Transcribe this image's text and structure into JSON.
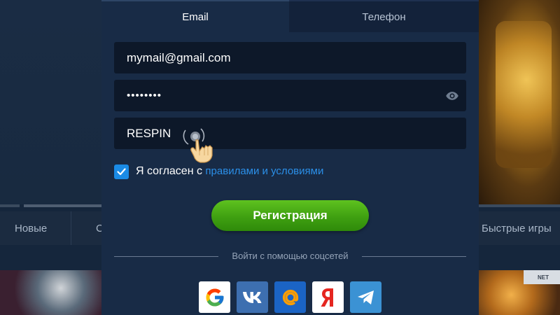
{
  "tabs": {
    "email": "Email",
    "phone": "Телефон"
  },
  "form": {
    "email_value": "mymail@gmail.com",
    "password_value": "••••••••",
    "promo_value": "RESPIN",
    "agree_prefix": "Я согласен с ",
    "agree_link": "правилами и условиями",
    "agree_checked": true,
    "register_label": "Регистрация"
  },
  "social": {
    "divider_text": "Войти с помощью соцсетей",
    "networks": [
      "google-icon",
      "vk-icon",
      "mail-ru-icon",
      "yandex-icon",
      "telegram-icon"
    ]
  },
  "background": {
    "nav_items": [
      "Новые",
      "С",
      "Быстрые игры"
    ],
    "badge": "NET"
  },
  "colors": {
    "modal_bg": "#182b46",
    "field_bg": "#0d1829",
    "accent_link": "#2b8fe8",
    "register_green": "#3fa011",
    "checkbox_blue": "#1a8be6"
  }
}
